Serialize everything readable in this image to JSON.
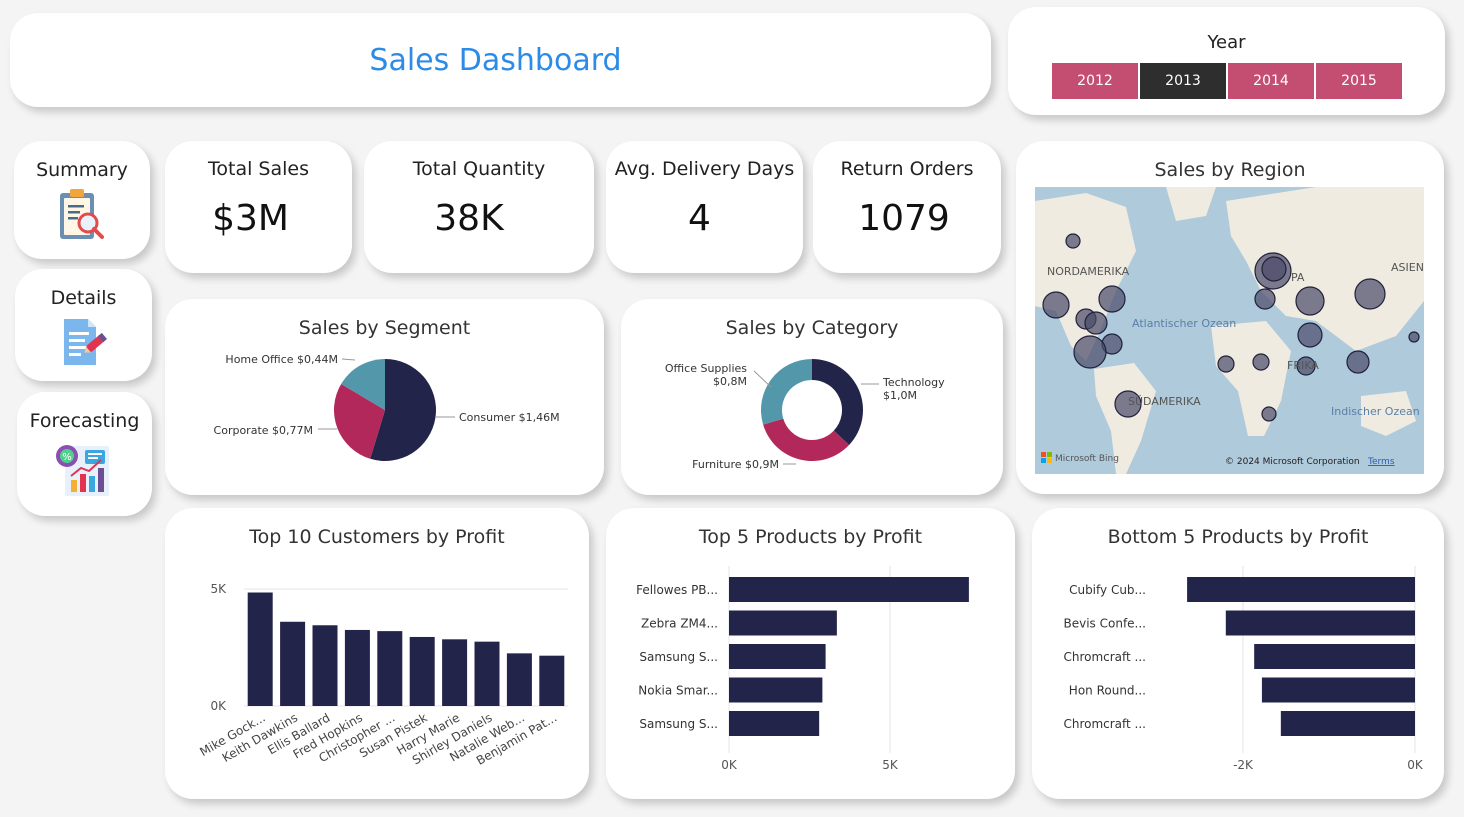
{
  "title": "Sales Dashboard",
  "year_slicer": {
    "label": "Year",
    "years": [
      "2012",
      "2013",
      "2014",
      "2015"
    ],
    "selected": "2013",
    "colors": {
      "default": "#c44e72",
      "selected": "#2e2e2e"
    }
  },
  "nav": [
    {
      "label": "Summary",
      "icon": "clipboard-search-icon"
    },
    {
      "label": "Details",
      "icon": "document-edit-icon"
    },
    {
      "label": "Forecasting",
      "icon": "chart-forecast-icon"
    }
  ],
  "kpis": [
    {
      "title": "Total Sales",
      "value": "$3M"
    },
    {
      "title": "Total Quantity",
      "value": "38K"
    },
    {
      "title": "Avg. Delivery Days",
      "value": "4"
    },
    {
      "title": "Return Orders",
      "value": "1079"
    }
  ],
  "map": {
    "title": "Sales by Region",
    "labels": [
      "NORDAMERIKA",
      "Atlantischer Ozean",
      "PA",
      "ASIEN",
      "FRIKA",
      "SÜDAMERIKA",
      "Indischer Ozean"
    ],
    "attribution": "Microsoft Bing",
    "copyright": "© 2024 Microsoft Corporation",
    "terms": "Terms"
  },
  "chart_data": [
    {
      "type": "pie",
      "title": "Sales by Segment",
      "slices": [
        {
          "name": "Consumer",
          "label": "Consumer $1,46M",
          "value": 1.46,
          "color": "#23244a"
        },
        {
          "name": "Corporate",
          "label": "Corporate $0,77M",
          "value": 0.77,
          "color": "#b3285a"
        },
        {
          "name": "Home Office",
          "label": "Home Office $0,44M",
          "value": 0.44,
          "color": "#5397ab"
        }
      ]
    },
    {
      "type": "pie",
      "subtype": "donut",
      "title": "Sales by Category",
      "slices": [
        {
          "name": "Technology",
          "label_lines": [
            "Technology",
            "$1,0M"
          ],
          "value": 1.0,
          "color": "#23244a"
        },
        {
          "name": "Furniture",
          "label_lines": [
            "Furniture $0,9M"
          ],
          "value": 0.9,
          "color": "#b3285a"
        },
        {
          "name": "Office Supplies",
          "label_lines": [
            "Office Supplies",
            "$0,8M"
          ],
          "value": 0.8,
          "color": "#5397ab"
        }
      ]
    },
    {
      "type": "bar",
      "title": "Top 10 Customers by Profit",
      "categories": [
        "Mike Gock...",
        "Keith Dawkins",
        "Ellis Ballard",
        "Fred Hopkins",
        "Christopher ...",
        "Susan Pistek",
        "Harry Marie",
        "Shirley Daniels",
        "Natalie Web...",
        "Benjamin Pat..."
      ],
      "values": [
        4850,
        3600,
        3450,
        3250,
        3200,
        2950,
        2850,
        2750,
        2250,
        2150
      ],
      "yticks": [
        "0K",
        "5K"
      ],
      "ylim": [
        0,
        5000
      ],
      "color": "#23244a"
    },
    {
      "type": "bar",
      "orientation": "horizontal",
      "title": "Top 5 Products by Profit",
      "categories": [
        "Fellowes PB...",
        "Zebra ZM4...",
        "Samsung S...",
        "Nokia Smar...",
        "Samsung S..."
      ],
      "values": [
        7450,
        3350,
        3000,
        2900,
        2800
      ],
      "xticks": [
        "0K",
        "5K"
      ],
      "xlim": [
        0,
        5000
      ],
      "color": "#23244a"
    },
    {
      "type": "bar",
      "orientation": "horizontal",
      "title": "Bottom 5 Products by Profit",
      "categories": [
        "Cubify Cub...",
        "Bevis Confe...",
        "Chromcraft ...",
        "Hon Round...",
        "Chromcraft ..."
      ],
      "values": [
        -2650,
        -2200,
        -1870,
        -1780,
        -1560
      ],
      "xticks": [
        "-2K",
        "0K"
      ],
      "xlim": [
        -2000,
        0
      ],
      "color": "#23244a"
    }
  ]
}
